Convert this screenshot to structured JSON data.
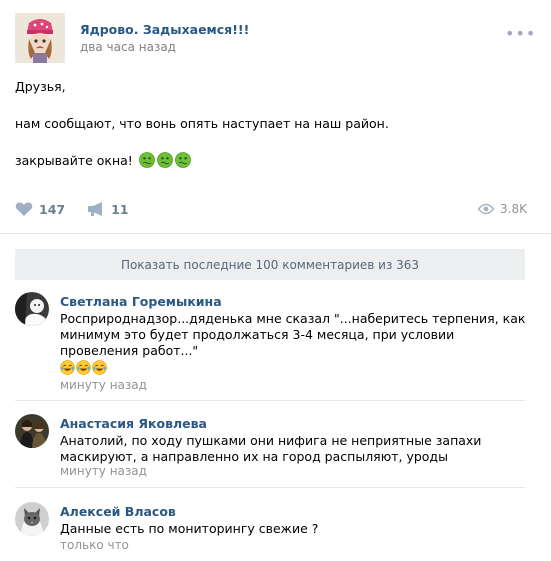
{
  "post": {
    "author": "Ядрово. Задыхаемся!!!",
    "time": "два часа назад",
    "more_icon": "more-dots-icon",
    "text": {
      "line1": "Друзья,",
      "line2": "нам сообщают, что вонь опять наступает на наш район.",
      "line3": "закрывайте окна!",
      "emojis": [
        "sick-face-icon",
        "sick-face-icon",
        "sick-face-icon"
      ]
    },
    "likes": "147",
    "shares": "11",
    "views": "3.8K"
  },
  "comments_header": {
    "show_more_label": "Показать последние 100 комментариев из 363"
  },
  "comments": [
    {
      "name": "Светлана Горемыкина",
      "text": "Росприроднадзор...дяденька мне сказал \"...наберитесь терпения, как минимум это будет продолжаться 3-4 месяца, при условии провеления работ...\"",
      "emojis": [
        "laughing-tears-icon",
        "laughing-tears-icon",
        "laughing-tears-icon"
      ],
      "time": "минуту назад"
    },
    {
      "name": "Анастасия Яковлева",
      "text": "Анатолий, по ходу пушками они нифига не неприятные запахи маскируют, а направленно их на город распыляют, уроды",
      "time": "минуту назад"
    },
    {
      "name": "Алексей Власов",
      "text": "Данные есть по мониторингу свежие ?",
      "time": "только что"
    }
  ],
  "colors": {
    "link": "#2a5885",
    "meta": "#828282",
    "action": "#6f7e8f",
    "show_more_bg": "#edeef0"
  }
}
